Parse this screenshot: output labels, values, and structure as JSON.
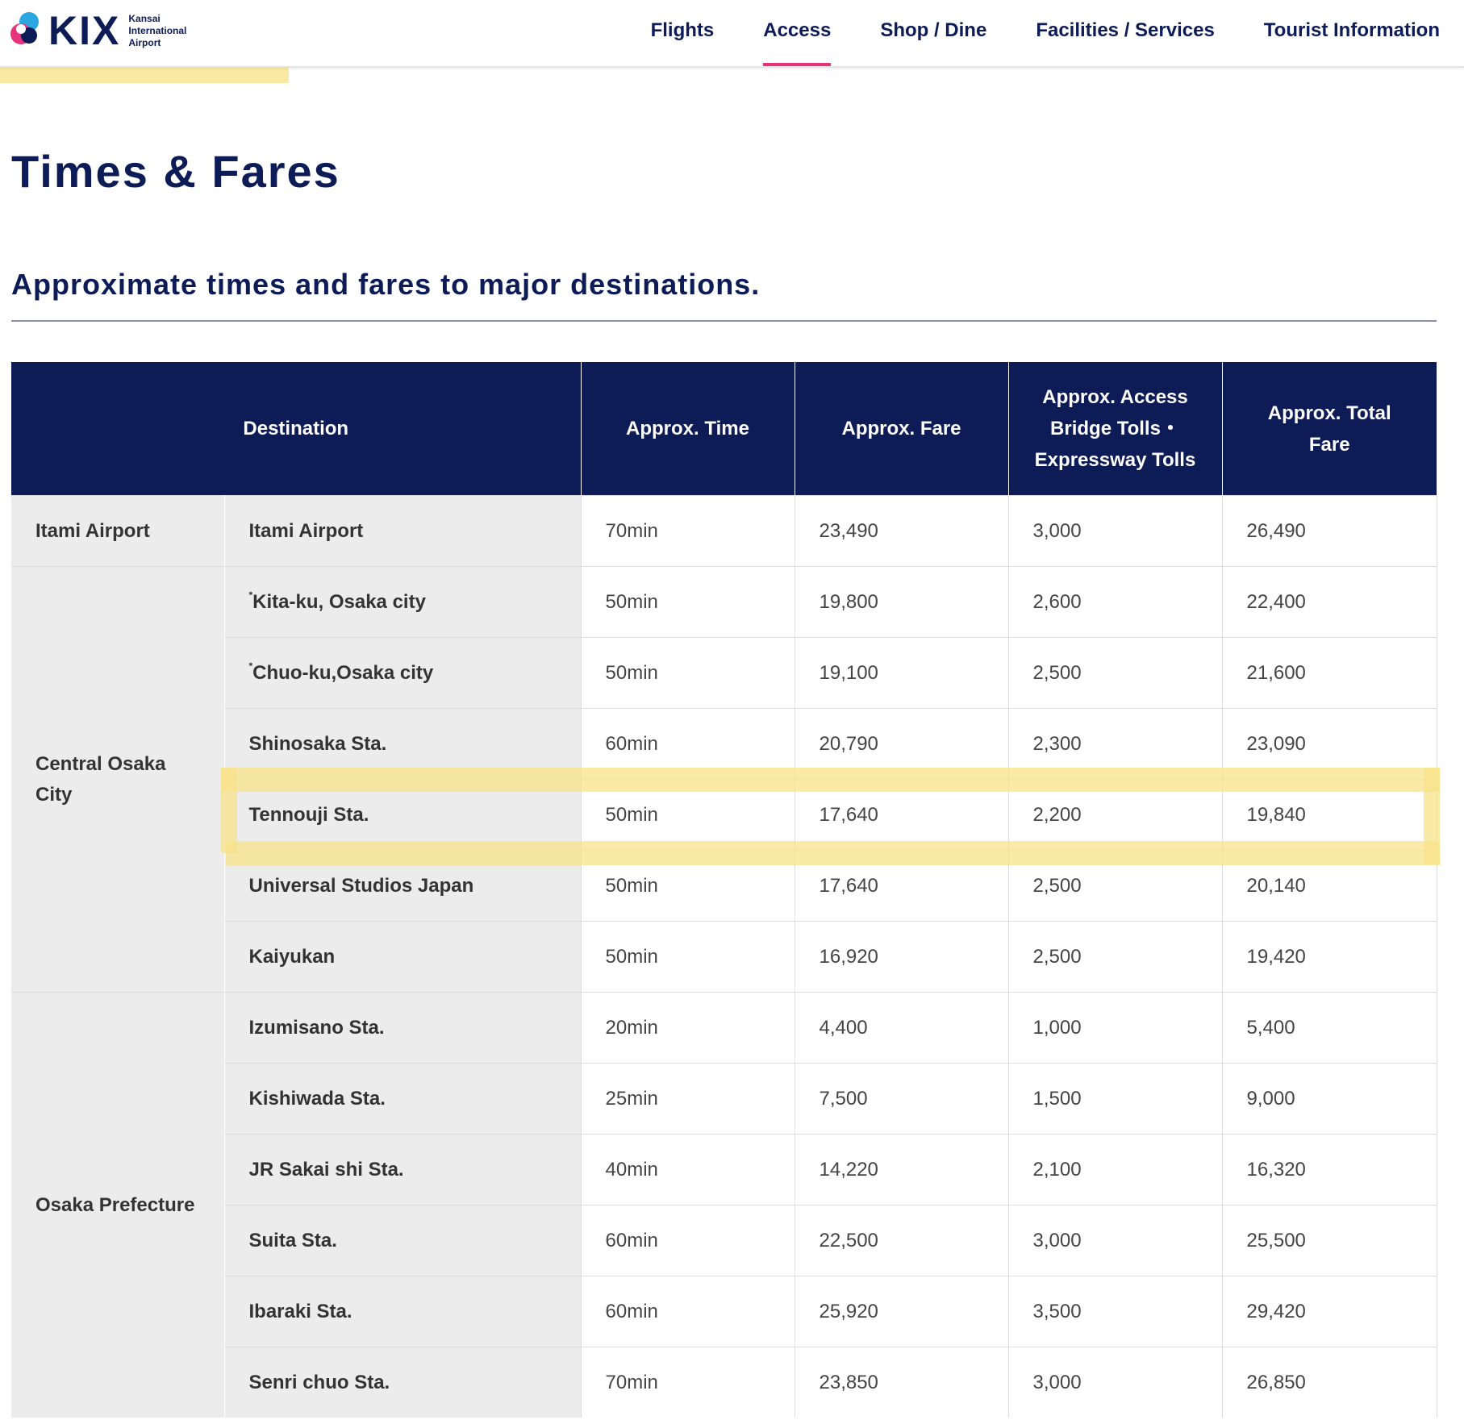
{
  "logo": {
    "text": "KIX",
    "sub1": "Kansai",
    "sub2": "International",
    "sub3": "Airport"
  },
  "nav": [
    {
      "label": "Flights",
      "active": false
    },
    {
      "label": "Access",
      "active": true
    },
    {
      "label": "Shop / Dine",
      "active": false
    },
    {
      "label": "Facilities / Services",
      "active": false
    },
    {
      "label": "Tourist Information",
      "active": false
    }
  ],
  "page": {
    "title": "Times & Fares",
    "subtitle": "Approximate times and fares to major destinations."
  },
  "table": {
    "headers": {
      "destination": "Destination",
      "time": "Approx. Time",
      "fare": "Approx. Fare",
      "tolls_line1": "Approx. Access",
      "tolls_line2": "Bridge Tolls・",
      "tolls_line3": "Expressway Tolls",
      "total_line1": "Approx. Total",
      "total_line2": "Fare"
    },
    "groups": {
      "g0": "Itami Airport",
      "g1_line1": "Central Osaka",
      "g1_line2": "City",
      "g2": "Osaka Prefecture"
    },
    "rows": [
      {
        "dest": "Itami Airport",
        "time": "70min",
        "fare": "23,490",
        "tolls": "3,000",
        "total": "26,490"
      },
      {
        "mark": "*",
        "dest": "Kita-ku, Osaka city",
        "time": "50min",
        "fare": "19,800",
        "tolls": "2,600",
        "total": "22,400"
      },
      {
        "mark": "*",
        "dest": "Chuo-ku,Osaka city",
        "time": "50min",
        "fare": "19,100",
        "tolls": "2,500",
        "total": "21,600"
      },
      {
        "dest": "Shinosaka Sta.",
        "time": "60min",
        "fare": "20,790",
        "tolls": "2,300",
        "total": "23,090"
      },
      {
        "dest": "Tennouji Sta.",
        "time": "50min",
        "fare": "17,640",
        "tolls": "2,200",
        "total": "19,840"
      },
      {
        "dest": "Universal Studios Japan",
        "time": "50min",
        "fare": "17,640",
        "tolls": "2,500",
        "total": "20,140"
      },
      {
        "dest": "Kaiyukan",
        "time": "50min",
        "fare": "16,920",
        "tolls": "2,500",
        "total": "19,420"
      },
      {
        "dest": "Izumisano Sta.",
        "time": "20min",
        "fare": "4,400",
        "tolls": "1,000",
        "total": "5,400"
      },
      {
        "dest": "Kishiwada Sta.",
        "time": "25min",
        "fare": "7,500",
        "tolls": "1,500",
        "total": "9,000"
      },
      {
        "dest": "JR Sakai shi Sta.",
        "time": "40min",
        "fare": "14,220",
        "tolls": "2,100",
        "total": "16,320"
      },
      {
        "dest": "Suita Sta.",
        "time": "60min",
        "fare": "22,500",
        "tolls": "3,000",
        "total": "25,500"
      },
      {
        "dest": "Ibaraki Sta.",
        "time": "60min",
        "fare": "25,920",
        "tolls": "3,500",
        "total": "29,420"
      },
      {
        "dest": "Senri chuo Sta.",
        "time": "70min",
        "fare": "23,850",
        "tolls": "3,000",
        "total": "26,850"
      }
    ]
  },
  "colors": {
    "navy": "#0d1b57",
    "accent": "#e6347c",
    "highlight": "#f8e38a",
    "cell_gray": "#ececec"
  }
}
